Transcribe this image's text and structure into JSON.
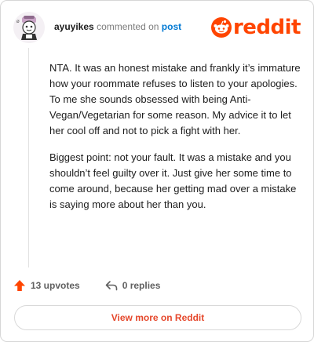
{
  "header": {
    "username": "ayuyikes",
    "action_text": "commented on",
    "target_link": "post",
    "logo_text": "reddit"
  },
  "comment": {
    "paragraphs": [
      "NTA. It was an honest mistake and frankly it’s immature how your roommate refuses to listen to your apologies. To me she sounds obsessed with being Anti-Vegan/Vegetarian for some reason. My advice it to let her cool off and not to pick a fight with her.",
      "Biggest point: not your fault. It was a mistake and you shouldn’t feel guilty over it. Just give her some time to come around, because her getting mad over a mistake is saying more about her than you."
    ]
  },
  "footer": {
    "upvotes_label": "13 upvotes",
    "replies_label": "0 replies",
    "view_more_label": "View more on Reddit"
  },
  "icons": {
    "upvote": "arrow-up-icon",
    "reply": "reply-arrow-icon",
    "logo": "reddit-snoo-icon"
  },
  "colors": {
    "brand": "#ff4500",
    "link": "#0079d3",
    "view_more": "#e5482c"
  }
}
